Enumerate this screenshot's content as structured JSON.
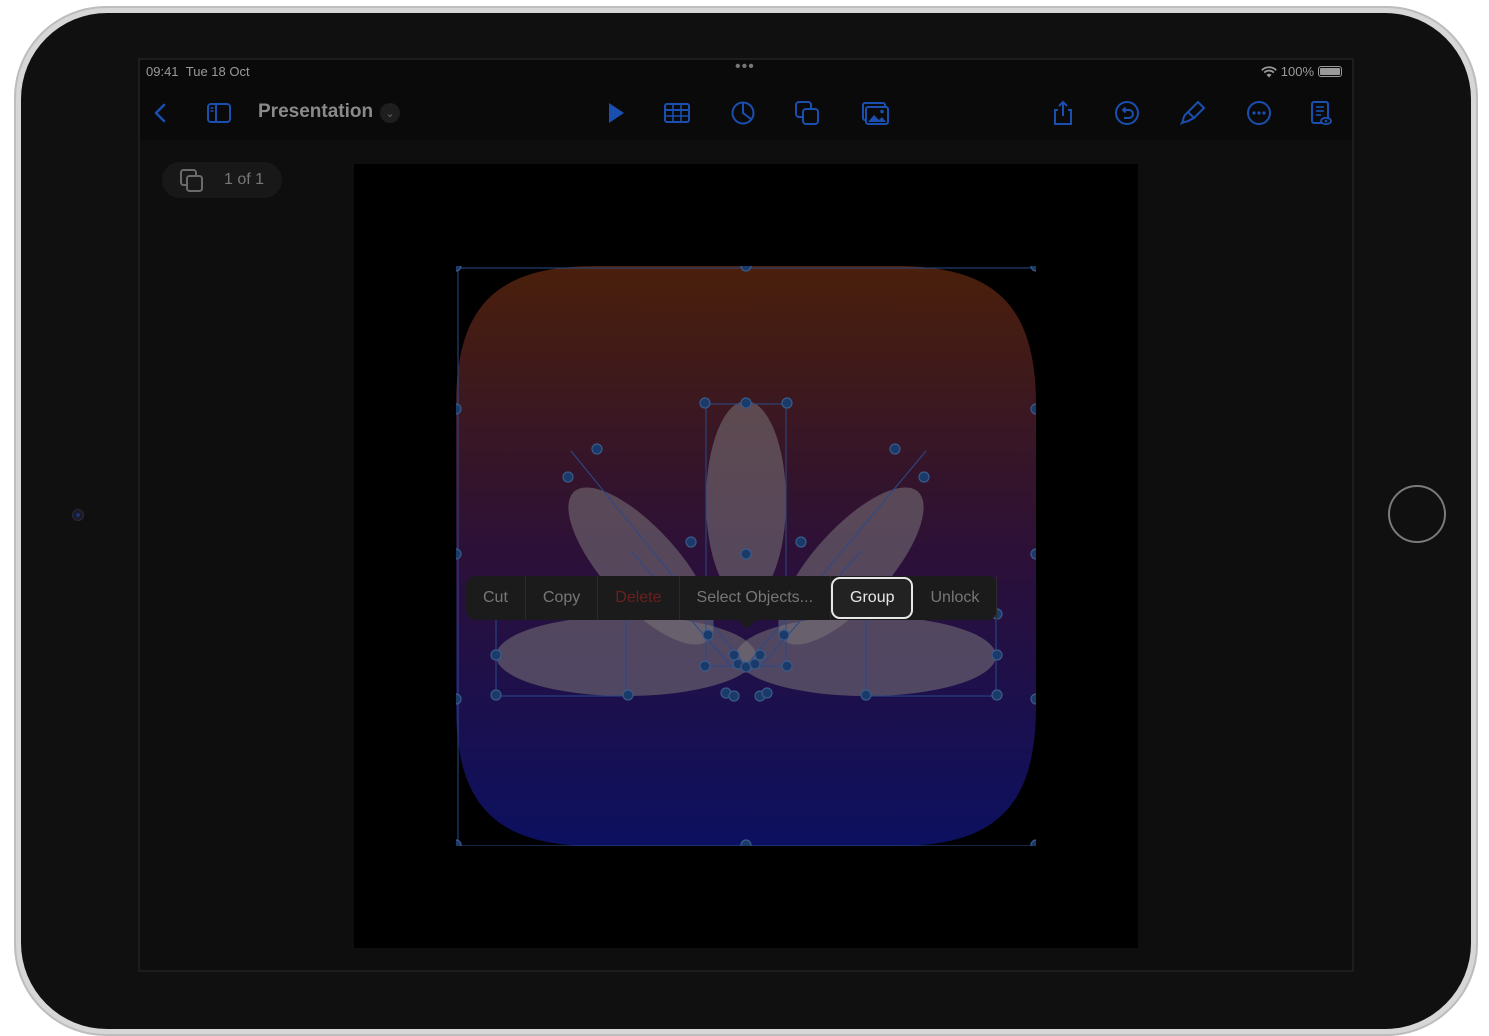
{
  "status_bar": {
    "time": "09:41",
    "date": "Tue 18 Oct",
    "center_dots": "•••",
    "battery_percent": "100%"
  },
  "toolbar": {
    "back_icon": "chevron-left-icon",
    "sidebar_icon": "sidebar-icon",
    "document_title": "Presentation",
    "title_menu_icon": "chevron-down-icon",
    "play_icon": "play-icon",
    "table_icon": "table-icon",
    "chart_icon": "chart-icon",
    "shapes_icon": "shapes-icon",
    "media_icon": "media-icon",
    "share_icon": "share-icon",
    "undo_icon": "undo-icon",
    "format_icon": "paintbrush-icon",
    "more_icon": "ellipsis-icon",
    "presenter_icon": "document-viewer-icon",
    "accent_color": "#1a4fb0"
  },
  "slide_navigator": {
    "counter": "1 of 1"
  },
  "slide": {
    "gradient_top": "#4a1f0a",
    "gradient_bottom": "#0c1060",
    "petal_color": "#7a7478"
  },
  "context_menu": {
    "items": [
      {
        "label": "Cut"
      },
      {
        "label": "Copy"
      },
      {
        "label": "Delete"
      },
      {
        "label": "Select Objects..."
      },
      {
        "label": "Group"
      },
      {
        "label": "Unlock"
      }
    ],
    "selected": "Group",
    "destructive_color": "#8b2a2a"
  }
}
